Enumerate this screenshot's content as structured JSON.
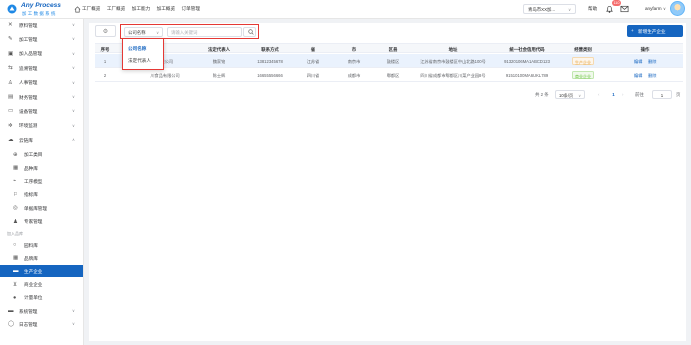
{
  "app": {
    "logo_title": "Any Process",
    "logo_subtitle": "加工数据系统",
    "brand_color": "#1565c0"
  },
  "topnav": [
    "工厂概览",
    "工厂概览",
    "加工能力",
    "加工概览",
    "订单管理"
  ],
  "header": {
    "company": "青岛市XX加...",
    "help_label": "帮助",
    "notification_count": "110",
    "username": "anyfarm"
  },
  "sidebar": {
    "items": [
      {
        "label": "原料管理",
        "icon": "tools-icon"
      },
      {
        "label": "加工管理",
        "icon": "wrench-icon"
      },
      {
        "label": "加入品管理",
        "icon": "box-icon"
      },
      {
        "label": "追溯管理",
        "icon": "trace-icon"
      },
      {
        "label": "人事管理",
        "icon": "person-icon"
      },
      {
        "label": "财务管理",
        "icon": "finance-icon"
      },
      {
        "label": "设备管理",
        "icon": "device-icon"
      },
      {
        "label": "环境监测",
        "icon": "environment-icon"
      },
      {
        "label": "云链库",
        "icon": "cloud-icon"
      }
    ],
    "cloud_children": [
      {
        "label": "加工类目",
        "icon": "category-icon"
      },
      {
        "label": "品种库",
        "icon": "variety-icon"
      },
      {
        "label": "工序模型",
        "icon": "process-icon"
      },
      {
        "label": "指标库",
        "icon": "flag-icon"
      },
      {
        "label": "单据库管理",
        "icon": "document-icon"
      },
      {
        "label": "专家管理",
        "icon": "experts-icon"
      }
    ],
    "group_label": "加入品库",
    "group_children": [
      {
        "label": "园料库",
        "icon": "circle-icon"
      },
      {
        "label": "品牌库",
        "icon": "brand-icon"
      },
      {
        "label": "生产企业",
        "icon": "factory-icon",
        "active": true
      },
      {
        "label": "商业企业",
        "icon": "cart-icon"
      },
      {
        "label": "计量单位",
        "icon": "pin-icon"
      }
    ],
    "bottom_items": [
      {
        "label": "系统管理",
        "icon": "system-icon"
      },
      {
        "label": "日志管理",
        "icon": "log-icon"
      }
    ]
  },
  "toolbar": {
    "search_field": "公司名称",
    "search_placeholder": "请输入关键词",
    "add_button": "新增生产企业"
  },
  "dropdown": {
    "options": [
      "公司名称",
      "法定代表人"
    ],
    "selected": "公司名称"
  },
  "table": {
    "columns": [
      "序号",
      "公司名称",
      "法定代表人",
      "联系方式",
      "省",
      "市",
      "区县",
      "地址",
      "统一社会信用代码",
      "经营类别",
      "操作"
    ],
    "rows": [
      {
        "index": "1",
        "name": "...有限公司",
        "legal_rep": "魏家铭",
        "phone": "13812345678",
        "province": "江苏省",
        "city": "南京市",
        "district": "鼓楼区",
        "address": "江苏省南京市鼓楼区中山北路100号",
        "credit_code": "91320106MA1ABCD123",
        "category": "生产企业",
        "category_color": "#e6a23c",
        "edit": "编辑",
        "delete": "删除"
      },
      {
        "index": "2",
        "name": "川食品有限公司",
        "legal_rep": "陈士辉",
        "phone": "16655556666",
        "province": "四川省",
        "city": "成都市",
        "district": "郫都区",
        "address": "四川省成都市郫都区川菜产业园8号",
        "credit_code": "91510100MA6UKL789",
        "category": "商业企业",
        "category_color": "#67c23a",
        "edit": "编辑",
        "delete": "删除"
      }
    ]
  },
  "pagination": {
    "total": "共 2 条",
    "page_size": "10条/页",
    "current": "1",
    "goto_label": "前往",
    "goto_value": "1",
    "page_suffix": "页"
  }
}
